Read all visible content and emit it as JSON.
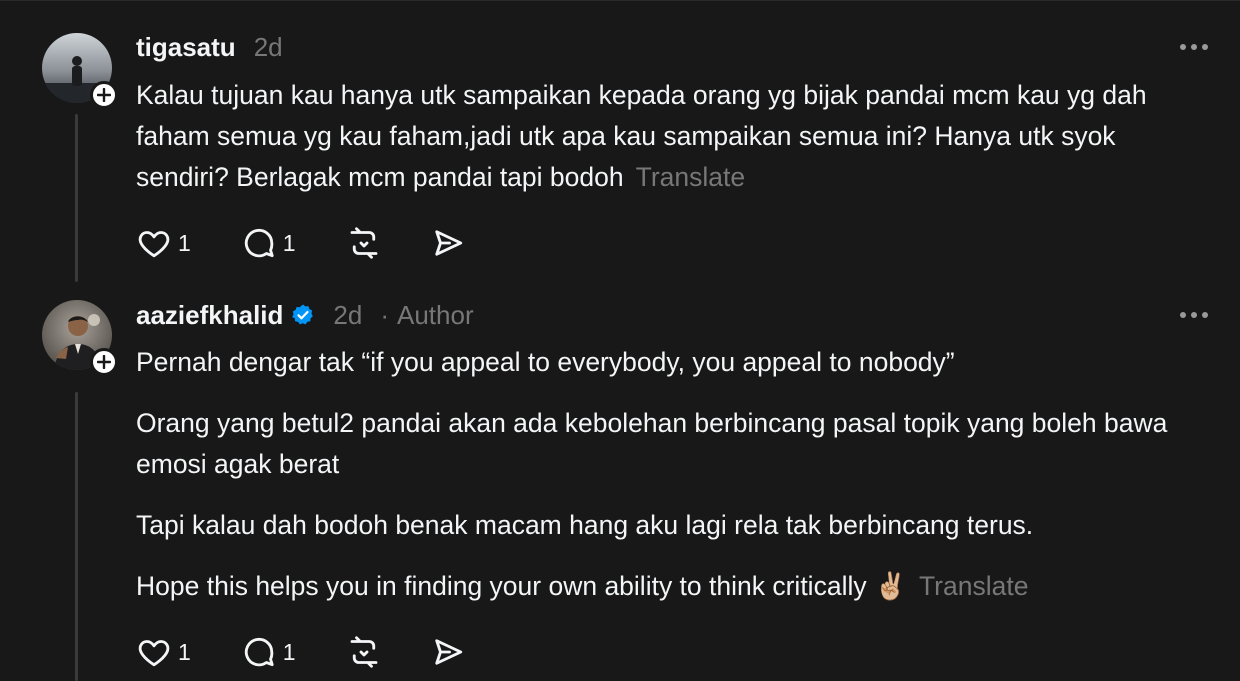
{
  "colors": {
    "background": "#181818",
    "text_primary": "#f3f5f7",
    "text_secondary": "#777777",
    "verified_blue": "#0095f6",
    "thread_line": "#3a3a3a"
  },
  "posts": [
    {
      "username": "tigasatu",
      "time": "2d",
      "verified": false,
      "author_label": "",
      "avatar_icon": "profile-photo-silhouette",
      "paragraphs": [
        "Kalau tujuan kau hanya utk sampaikan kepada orang yg bijak pandai mcm kau yg dah faham semua yg kau faham,jadi utk apa kau sampaikan semua ini? Hanya utk syok sendiri? Berlagak mcm pandai tapi bodoh"
      ],
      "translate_label": "Translate",
      "like_count": "1",
      "reply_count": "1"
    },
    {
      "username": "aaziefkhalid",
      "time": "2d",
      "verified": true,
      "separator": "·",
      "author_label": "Author",
      "avatar_icon": "profile-photo-man-suit",
      "paragraphs": [
        "Pernah dengar tak “if you appeal to everybody, you appeal to nobody”",
        "Orang yang betul2 pandai akan ada kebolehan berbincang pasal topik yang boleh bawa emosi agak berat",
        "Tapi kalau dah bodoh benak macam hang aku lagi rela tak berbincang terus.",
        "Hope this helps you in finding your own ability to think critically ✌🏼"
      ],
      "translate_label": "Translate",
      "like_count": "1",
      "reply_count": "1"
    }
  ]
}
